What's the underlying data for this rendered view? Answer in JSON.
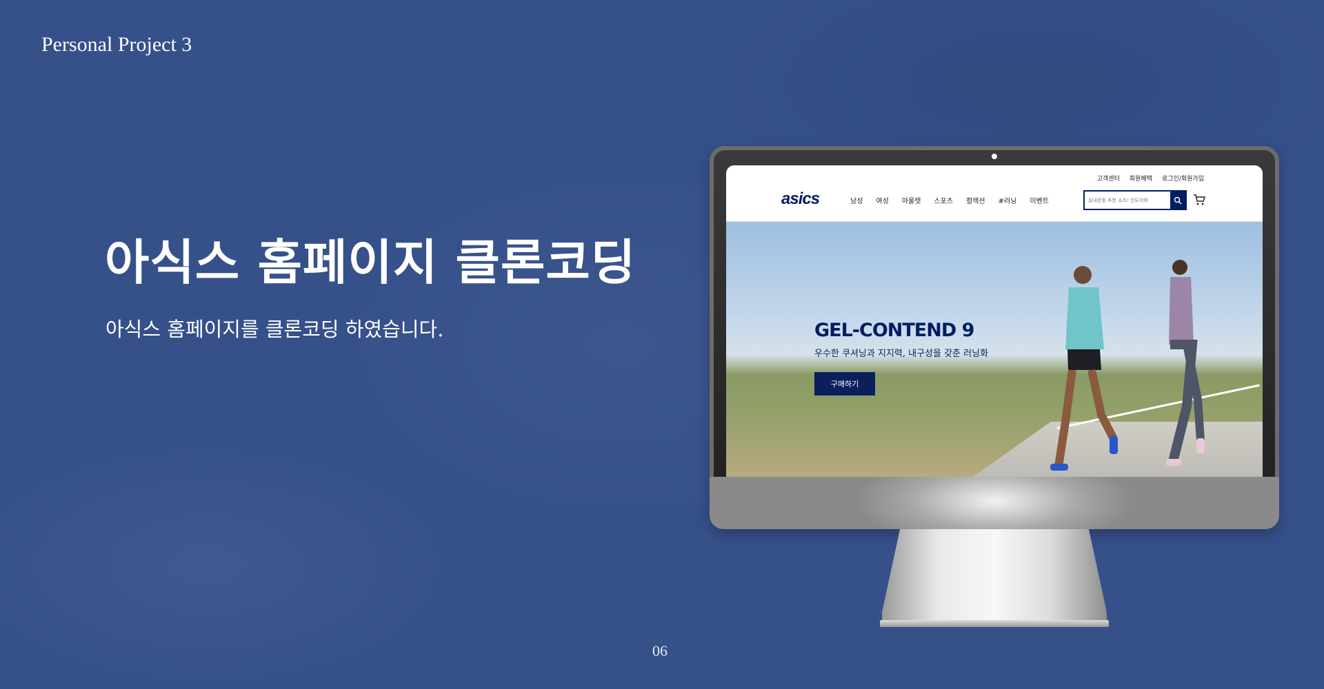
{
  "slide": {
    "project_label": "Personal Project 3",
    "title": "아식스 홈페이지 클론코딩",
    "subtitle": "아식스 홈페이지를 클론코딩 하였습니다.",
    "page_number": "06"
  },
  "site": {
    "logo": "asics",
    "util_nav": [
      "고객센터",
      "회원혜택",
      "로그인/회원가입"
    ],
    "main_nav": [
      "남성",
      "여성",
      "아울렛",
      "스포츠",
      "컬렉션",
      "#러닝",
      "이벤트"
    ],
    "search_placeholder": "실내운동 추천 슈즈! 인도어화",
    "hero": {
      "title": "GEL-CONTEND 9",
      "subtitle": "우수한 쿠셔닝과 지지력, 내구성을 갖춘 러닝화",
      "button": "구매하기"
    }
  },
  "colors": {
    "background": "#36508a",
    "brand_navy": "#001e62"
  },
  "icons": [
    "search-icon",
    "cart-icon",
    "camera-dot"
  ]
}
